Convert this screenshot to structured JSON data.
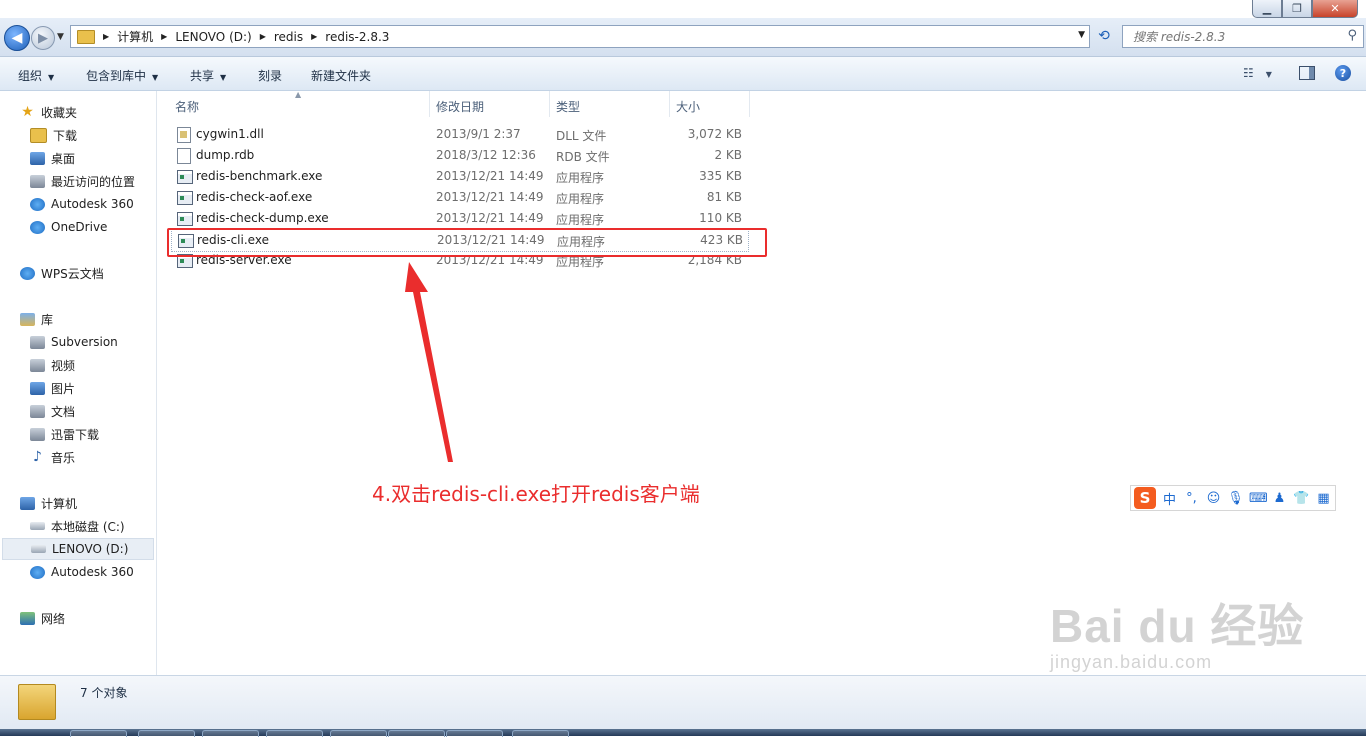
{
  "window": {
    "minimize_glyph": "▁",
    "maximize_glyph": "❐",
    "close_glyph": "✕"
  },
  "address": {
    "crumbs": [
      "计算机",
      "LENOVO (D:)",
      "redis",
      "redis-2.8.3"
    ],
    "search_placeholder": "搜索 redis-2.8.3"
  },
  "toolbar": {
    "organize": "组织",
    "include_library": "包含到库中",
    "share": "共享",
    "burn": "刻录",
    "new_folder": "新建文件夹"
  },
  "sidebar": {
    "favorites": "收藏夹",
    "downloads": "下载",
    "desktop": "桌面",
    "recent": "最近访问的位置",
    "autodesk360_fav": "Autodesk 360",
    "onedrive": "OneDrive",
    "wps_cloud": "WPS云文档",
    "libraries": "库",
    "subversion": "Subversion",
    "videos": "视频",
    "pictures": "图片",
    "documents": "文档",
    "thunder": "迅雷下载",
    "music": "音乐",
    "computer": "计算机",
    "local_disk": "本地磁盘 (C:)",
    "lenovo_d": "LENOVO (D:)",
    "autodesk360_comp": "Autodesk 360",
    "network": "网络"
  },
  "columns": {
    "name": "名称",
    "modified": "修改日期",
    "type": "类型",
    "size": "大小"
  },
  "files": [
    {
      "name": "cygwin1.dll",
      "date": "2013/9/1 2:37",
      "type": "DLL 文件",
      "size": "3,072 KB"
    },
    {
      "name": "dump.rdb",
      "date": "2018/3/12 12:36",
      "type": "RDB 文件",
      "size": "2 KB"
    },
    {
      "name": "redis-benchmark.exe",
      "date": "2013/12/21 14:49",
      "type": "应用程序",
      "size": "335 KB"
    },
    {
      "name": "redis-check-aof.exe",
      "date": "2013/12/21 14:49",
      "type": "应用程序",
      "size": "81 KB"
    },
    {
      "name": "redis-check-dump.exe",
      "date": "2013/12/21 14:49",
      "type": "应用程序",
      "size": "110 KB"
    },
    {
      "name": "redis-cli.exe",
      "date": "2013/12/21 14:49",
      "type": "应用程序",
      "size": "423 KB"
    },
    {
      "name": "redis-server.exe",
      "date": "2013/12/21 14:49",
      "type": "应用程序",
      "size": "2,184 KB"
    }
  ],
  "annotation": {
    "text": "4.双击redis-cli.exe打开redis客户端",
    "color": "#ea2d2d"
  },
  "ime": {
    "logo": "S",
    "mode": "中",
    "punct": "°,"
  },
  "status": {
    "count": "7 个对象"
  },
  "watermark": {
    "main": "Bai du 经验",
    "sub": "jingyan.baidu.com"
  }
}
